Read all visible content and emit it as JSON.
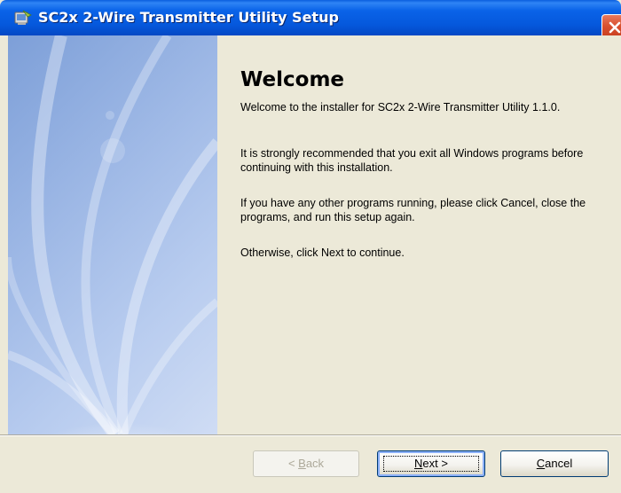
{
  "window": {
    "title": "SC2x 2-Wire Transmitter Utility Setup"
  },
  "content": {
    "heading": "Welcome",
    "paragraphs": [
      "Welcome to the installer for SC2x 2-Wire Transmitter Utility 1.1.0.",
      "It is strongly recommended that you exit all Windows programs before continuing with this installation.",
      "If you have any other programs running, please click Cancel, close the programs, and run this setup again.",
      "Otherwise, click Next to continue."
    ]
  },
  "buttons": {
    "back": {
      "prefix": "< ",
      "mnemonic": "B",
      "rest": "ack",
      "enabled": false
    },
    "next": {
      "mnemonic": "N",
      "rest": "ext >",
      "enabled": true,
      "focused": true
    },
    "cancel": {
      "mnemonic": "C",
      "rest": "ancel",
      "enabled": true
    }
  },
  "icons": {
    "app": "installer-app-icon",
    "close": "close-icon"
  },
  "colors": {
    "titlebar": "#0558dc",
    "dialog_background": "#ece9d8",
    "close_button": "#d9502e",
    "side_panel": "#9fb9e6"
  }
}
